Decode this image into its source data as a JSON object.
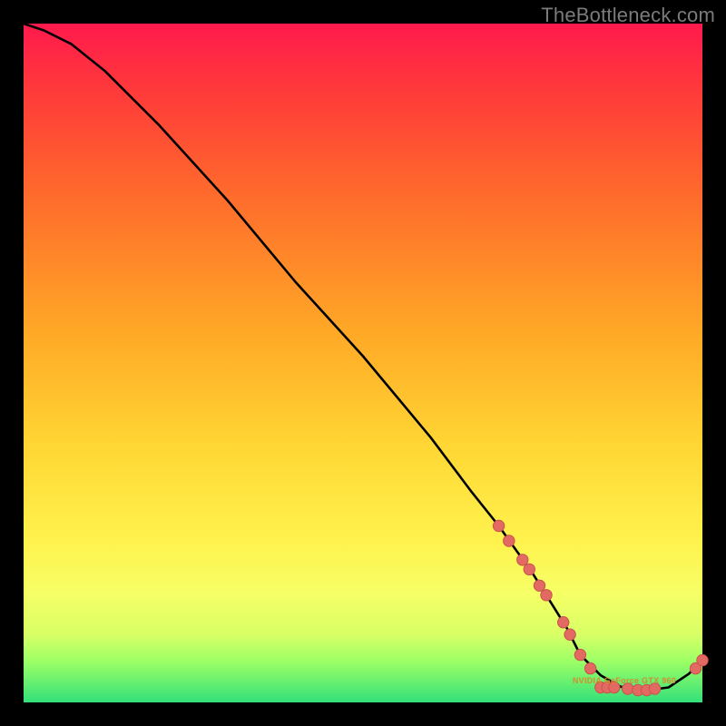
{
  "watermark": "TheBottleneck.com",
  "colors": {
    "bg_black": "#000000",
    "grad_top": "#ff1a4d",
    "grad_mid": "#ffd633",
    "grad_bot": "#33e07a",
    "curve": "#000000",
    "marker_fill": "#e36a62",
    "marker_stroke": "#c9524b"
  },
  "chart_data": {
    "type": "line",
    "title": "",
    "xlabel": "",
    "ylabel": "",
    "xlim": [
      0,
      100
    ],
    "ylim": [
      0,
      100
    ],
    "series": [
      {
        "name": "curve",
        "x": [
          0,
          3,
          7,
          12,
          20,
          30,
          40,
          50,
          60,
          66,
          70,
          75,
          80,
          82,
          85,
          88,
          92,
          95,
          98,
          100
        ],
        "y": [
          100,
          99,
          97,
          93,
          85,
          74,
          62,
          51,
          39,
          31,
          26,
          19,
          11,
          7,
          4,
          2.3,
          1.8,
          2.2,
          4.2,
          6.2
        ]
      }
    ],
    "markers": [
      {
        "x": 70.0,
        "y": 26.0
      },
      {
        "x": 71.5,
        "y": 23.8
      },
      {
        "x": 73.5,
        "y": 21.0
      },
      {
        "x": 74.5,
        "y": 19.6
      },
      {
        "x": 76.0,
        "y": 17.2
      },
      {
        "x": 77.0,
        "y": 15.8
      },
      {
        "x": 79.5,
        "y": 11.8
      },
      {
        "x": 80.5,
        "y": 10.0
      },
      {
        "x": 82.0,
        "y": 7.0
      },
      {
        "x": 83.5,
        "y": 5.0
      },
      {
        "x": 85.0,
        "y": 2.2
      },
      {
        "x": 86.0,
        "y": 2.2
      },
      {
        "x": 87.0,
        "y": 2.2
      },
      {
        "x": 89.0,
        "y": 2.0
      },
      {
        "x": 90.5,
        "y": 1.8
      },
      {
        "x": 91.8,
        "y": 1.8
      },
      {
        "x": 93.0,
        "y": 2.0
      },
      {
        "x": 99.0,
        "y": 5.0
      },
      {
        "x": 100.0,
        "y": 6.2
      }
    ],
    "marker_label": "NVIDIA GeForce GTX 960"
  }
}
